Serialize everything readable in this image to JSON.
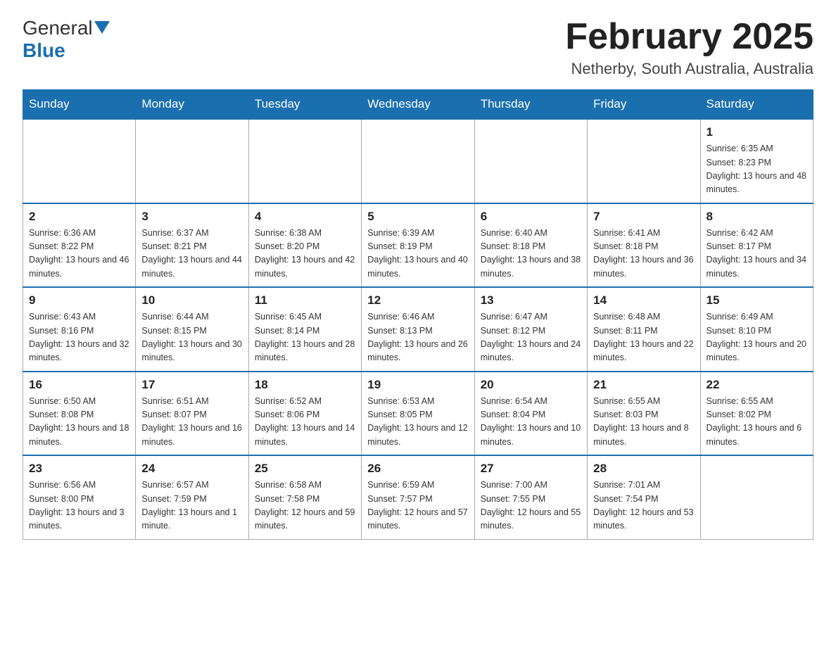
{
  "logo": {
    "general": "General",
    "blue": "Blue",
    "triangle": "▼"
  },
  "title": {
    "month": "February 2025",
    "location": "Netherby, South Australia, Australia"
  },
  "weekdays": [
    "Sunday",
    "Monday",
    "Tuesday",
    "Wednesday",
    "Thursday",
    "Friday",
    "Saturday"
  ],
  "weeks": [
    [
      {
        "day": "",
        "info": ""
      },
      {
        "day": "",
        "info": ""
      },
      {
        "day": "",
        "info": ""
      },
      {
        "day": "",
        "info": ""
      },
      {
        "day": "",
        "info": ""
      },
      {
        "day": "",
        "info": ""
      },
      {
        "day": "1",
        "info": "Sunrise: 6:35 AM\nSunset: 8:23 PM\nDaylight: 13 hours and 48 minutes."
      }
    ],
    [
      {
        "day": "2",
        "info": "Sunrise: 6:36 AM\nSunset: 8:22 PM\nDaylight: 13 hours and 46 minutes."
      },
      {
        "day": "3",
        "info": "Sunrise: 6:37 AM\nSunset: 8:21 PM\nDaylight: 13 hours and 44 minutes."
      },
      {
        "day": "4",
        "info": "Sunrise: 6:38 AM\nSunset: 8:20 PM\nDaylight: 13 hours and 42 minutes."
      },
      {
        "day": "5",
        "info": "Sunrise: 6:39 AM\nSunset: 8:19 PM\nDaylight: 13 hours and 40 minutes."
      },
      {
        "day": "6",
        "info": "Sunrise: 6:40 AM\nSunset: 8:18 PM\nDaylight: 13 hours and 38 minutes."
      },
      {
        "day": "7",
        "info": "Sunrise: 6:41 AM\nSunset: 8:18 PM\nDaylight: 13 hours and 36 minutes."
      },
      {
        "day": "8",
        "info": "Sunrise: 6:42 AM\nSunset: 8:17 PM\nDaylight: 13 hours and 34 minutes."
      }
    ],
    [
      {
        "day": "9",
        "info": "Sunrise: 6:43 AM\nSunset: 8:16 PM\nDaylight: 13 hours and 32 minutes."
      },
      {
        "day": "10",
        "info": "Sunrise: 6:44 AM\nSunset: 8:15 PM\nDaylight: 13 hours and 30 minutes."
      },
      {
        "day": "11",
        "info": "Sunrise: 6:45 AM\nSunset: 8:14 PM\nDaylight: 13 hours and 28 minutes."
      },
      {
        "day": "12",
        "info": "Sunrise: 6:46 AM\nSunset: 8:13 PM\nDaylight: 13 hours and 26 minutes."
      },
      {
        "day": "13",
        "info": "Sunrise: 6:47 AM\nSunset: 8:12 PM\nDaylight: 13 hours and 24 minutes."
      },
      {
        "day": "14",
        "info": "Sunrise: 6:48 AM\nSunset: 8:11 PM\nDaylight: 13 hours and 22 minutes."
      },
      {
        "day": "15",
        "info": "Sunrise: 6:49 AM\nSunset: 8:10 PM\nDaylight: 13 hours and 20 minutes."
      }
    ],
    [
      {
        "day": "16",
        "info": "Sunrise: 6:50 AM\nSunset: 8:08 PM\nDaylight: 13 hours and 18 minutes."
      },
      {
        "day": "17",
        "info": "Sunrise: 6:51 AM\nSunset: 8:07 PM\nDaylight: 13 hours and 16 minutes."
      },
      {
        "day": "18",
        "info": "Sunrise: 6:52 AM\nSunset: 8:06 PM\nDaylight: 13 hours and 14 minutes."
      },
      {
        "day": "19",
        "info": "Sunrise: 6:53 AM\nSunset: 8:05 PM\nDaylight: 13 hours and 12 minutes."
      },
      {
        "day": "20",
        "info": "Sunrise: 6:54 AM\nSunset: 8:04 PM\nDaylight: 13 hours and 10 minutes."
      },
      {
        "day": "21",
        "info": "Sunrise: 6:55 AM\nSunset: 8:03 PM\nDaylight: 13 hours and 8 minutes."
      },
      {
        "day": "22",
        "info": "Sunrise: 6:55 AM\nSunset: 8:02 PM\nDaylight: 13 hours and 6 minutes."
      }
    ],
    [
      {
        "day": "23",
        "info": "Sunrise: 6:56 AM\nSunset: 8:00 PM\nDaylight: 13 hours and 3 minutes."
      },
      {
        "day": "24",
        "info": "Sunrise: 6:57 AM\nSunset: 7:59 PM\nDaylight: 13 hours and 1 minute."
      },
      {
        "day": "25",
        "info": "Sunrise: 6:58 AM\nSunset: 7:58 PM\nDaylight: 12 hours and 59 minutes."
      },
      {
        "day": "26",
        "info": "Sunrise: 6:59 AM\nSunset: 7:57 PM\nDaylight: 12 hours and 57 minutes."
      },
      {
        "day": "27",
        "info": "Sunrise: 7:00 AM\nSunset: 7:55 PM\nDaylight: 12 hours and 55 minutes."
      },
      {
        "day": "28",
        "info": "Sunrise: 7:01 AM\nSunset: 7:54 PM\nDaylight: 12 hours and 53 minutes."
      },
      {
        "day": "",
        "info": ""
      }
    ]
  ]
}
